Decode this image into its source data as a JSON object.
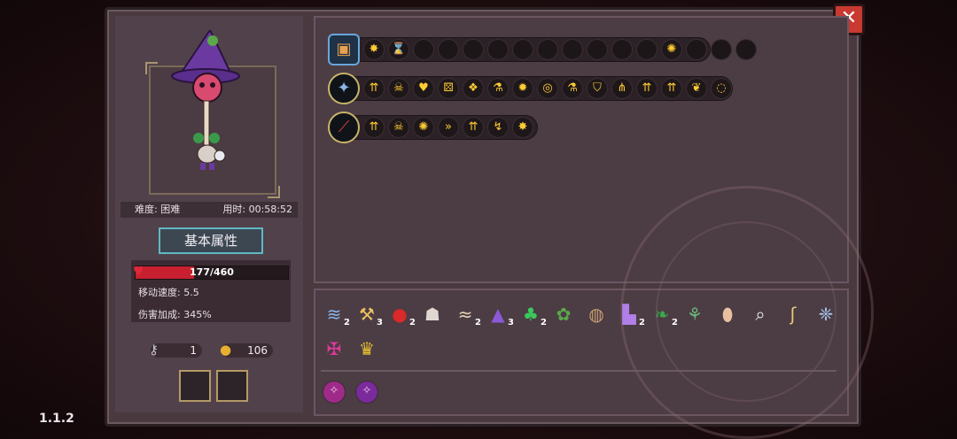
{
  "version": "1.1.2",
  "colors": {
    "hp": "#c82030",
    "accent": "#5fb9c4",
    "gold": "#e8b030"
  },
  "character": {
    "difficulty_label": "难度: 困难",
    "time_label": "用时: 00:58:52",
    "attr_button": "基本属性",
    "hp": {
      "current": 177,
      "max": 460,
      "text": "177/460"
    },
    "move_speed": "移动速度: 5.5",
    "damage_bonus": "伤害加成: 345%",
    "keys": "1",
    "coins": "106"
  },
  "weapon_rows": [
    {
      "weapon_icon": "chest-icon",
      "slots": [
        "star-burst-icon",
        "hourglass-icon",
        "",
        "",
        "",
        "",
        "",
        "",
        "",
        "",
        "",
        "",
        "fire-claw-icon",
        "",
        "",
        ""
      ]
    },
    {
      "weapon_icon": "staff-icon",
      "slots": [
        "arrows-up-icon",
        "skull-green-icon",
        "heart-icon",
        "dice-icon",
        "wing-icon",
        "potion-icon",
        "explosion-icon",
        "ring-icon",
        "potion-red-icon",
        "shield-icon",
        "split-icon",
        "arrows-up-icon",
        "arrows-up-icon",
        "leaf-icon",
        "spiral-icon"
      ]
    },
    {
      "weapon_icon": "wand-icon",
      "slots": [
        "arrows-up-icon",
        "skull-icon",
        "fire-claw-icon",
        "chevrons-icon",
        "arrows-up-icon",
        "bounce-icon",
        "star-burst-icon"
      ]
    }
  ],
  "items": [
    {
      "icon": "scarf-icon",
      "count": "2"
    },
    {
      "icon": "pickaxe-icon",
      "count": "3"
    },
    {
      "icon": "red-orb-icon",
      "count": "2"
    },
    {
      "icon": "mask-icon",
      "count": ""
    },
    {
      "icon": "bone-icon",
      "count": "2"
    },
    {
      "icon": "witch-hat-icon",
      "count": "3"
    },
    {
      "icon": "clover-icon",
      "count": "2"
    },
    {
      "icon": "frog-icon",
      "count": ""
    },
    {
      "icon": "bag-icon",
      "count": ""
    },
    {
      "icon": "boot-icon",
      "count": "2"
    },
    {
      "icon": "plant-icon",
      "count": "2"
    },
    {
      "icon": "claw-icon",
      "count": ""
    },
    {
      "icon": "egg-icon",
      "count": ""
    },
    {
      "icon": "magnifier-icon",
      "count": ""
    },
    {
      "icon": "worm-icon",
      "count": ""
    },
    {
      "icon": "wings-icon",
      "count": ""
    },
    {
      "icon": "demon-icon",
      "count": ""
    },
    {
      "icon": "crown-icon",
      "count": ""
    }
  ],
  "buffs": [
    "rune-pink-icon",
    "rune-violet-icon"
  ]
}
